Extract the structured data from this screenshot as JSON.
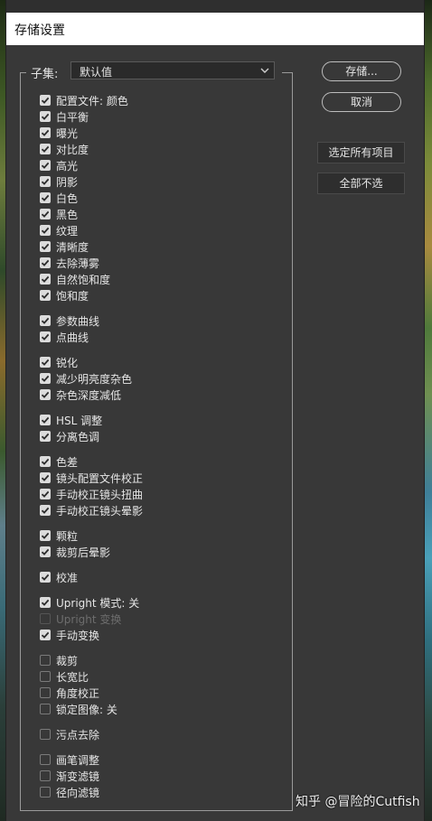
{
  "dialog": {
    "title": "存储设置",
    "subset_label": "子集:",
    "subset_value": "默认值"
  },
  "buttons": {
    "save": "存储...",
    "cancel": "取消",
    "select_all": "选定所有项目",
    "deselect_all": "全部不选"
  },
  "watermark": "知乎 @冒险的Cutfish",
  "options": [
    {
      "label": "配置文件: 颜色",
      "checked": true,
      "enabled": true
    },
    {
      "label": "白平衡",
      "checked": true,
      "enabled": true
    },
    {
      "label": "曝光",
      "checked": true,
      "enabled": true
    },
    {
      "label": "对比度",
      "checked": true,
      "enabled": true
    },
    {
      "label": "高光",
      "checked": true,
      "enabled": true
    },
    {
      "label": "阴影",
      "checked": true,
      "enabled": true
    },
    {
      "label": "白色",
      "checked": true,
      "enabled": true
    },
    {
      "label": "黑色",
      "checked": true,
      "enabled": true
    },
    {
      "label": "纹理",
      "checked": true,
      "enabled": true
    },
    {
      "label": "清晰度",
      "checked": true,
      "enabled": true
    },
    {
      "label": "去除薄雾",
      "checked": true,
      "enabled": true
    },
    {
      "label": "自然饱和度",
      "checked": true,
      "enabled": true
    },
    {
      "label": "饱和度",
      "checked": true,
      "enabled": true
    },
    {
      "label": "参数曲线",
      "checked": true,
      "enabled": true
    },
    {
      "label": "点曲线",
      "checked": true,
      "enabled": true
    },
    {
      "label": "锐化",
      "checked": true,
      "enabled": true
    },
    {
      "label": "减少明亮度杂色",
      "checked": true,
      "enabled": true
    },
    {
      "label": "杂色深度减低",
      "checked": true,
      "enabled": true
    },
    {
      "label": "HSL 调整",
      "checked": true,
      "enabled": true
    },
    {
      "label": "分离色调",
      "checked": true,
      "enabled": true
    },
    {
      "label": "色差",
      "checked": true,
      "enabled": true
    },
    {
      "label": "镜头配置文件校正",
      "checked": true,
      "enabled": true
    },
    {
      "label": "手动校正镜头扭曲",
      "checked": true,
      "enabled": true
    },
    {
      "label": "手动校正镜头晕影",
      "checked": true,
      "enabled": true
    },
    {
      "label": "颗粒",
      "checked": true,
      "enabled": true
    },
    {
      "label": "裁剪后晕影",
      "checked": true,
      "enabled": true
    },
    {
      "label": "校准",
      "checked": true,
      "enabled": true
    },
    {
      "label": "Upright 模式: 关",
      "checked": true,
      "enabled": true
    },
    {
      "label": "Upright 变换",
      "checked": false,
      "enabled": false
    },
    {
      "label": "手动变换",
      "checked": true,
      "enabled": true
    },
    {
      "label": "裁剪",
      "checked": false,
      "enabled": true
    },
    {
      "label": "长宽比",
      "checked": false,
      "enabled": true
    },
    {
      "label": "角度校正",
      "checked": false,
      "enabled": true
    },
    {
      "label": "锁定图像: 关",
      "checked": false,
      "enabled": true
    },
    {
      "label": "污点去除",
      "checked": false,
      "enabled": true
    },
    {
      "label": "画笔调整",
      "checked": false,
      "enabled": true
    },
    {
      "label": "渐变滤镜",
      "checked": false,
      "enabled": true
    },
    {
      "label": "径向滤镜",
      "checked": false,
      "enabled": true
    }
  ]
}
